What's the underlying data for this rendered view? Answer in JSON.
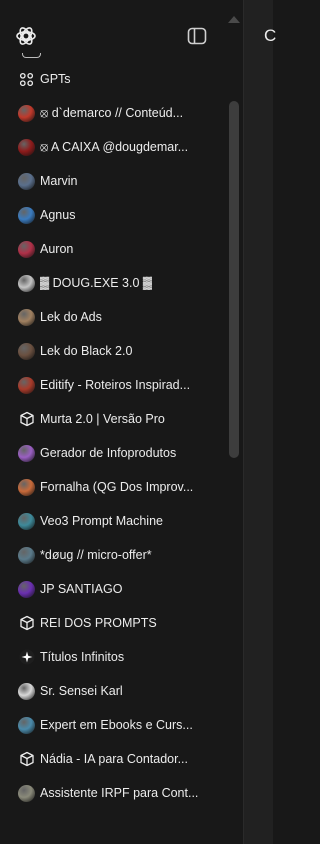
{
  "sidebar": {
    "items": [
      {
        "label": "GPTs",
        "icon": "grid-icon"
      },
      {
        "label": "⦻ d`demarco // Conteúd...",
        "icon": "avatar-ddemarco",
        "color": "#c0392b"
      },
      {
        "label": "⦻ A CAIXA @dougdemar...",
        "icon": "avatar-acaixa",
        "color": "#8e1b1b"
      },
      {
        "label": "Marvin",
        "icon": "avatar-marvin",
        "color": "#5a6f8c"
      },
      {
        "label": "Agnus",
        "icon": "avatar-agnus",
        "color": "#3a7bbf"
      },
      {
        "label": "Auron",
        "icon": "avatar-auron",
        "color": "#b03048"
      },
      {
        "label": "▓ DOUG.EXE 3.0 ▓",
        "icon": "avatar-dougexe",
        "color": "#c4c4c4"
      },
      {
        "label": "Lek do Ads",
        "icon": "avatar-lekads",
        "color": "#a08060"
      },
      {
        "label": "Lek do Black 2.0",
        "icon": "avatar-lekblack",
        "color": "#6a5040"
      },
      {
        "label": "Editify - Roteiros Inspirad...",
        "icon": "avatar-editify",
        "color": "#a83a2a"
      },
      {
        "label": "Murta 2.0 | Versão Pro",
        "icon": "cube-icon"
      },
      {
        "label": "Gerador de Infoprodutos",
        "icon": "avatar-gerador",
        "color": "#9a5fc2"
      },
      {
        "label": "Fornalha (QG Dos Improv...",
        "icon": "avatar-fornalha",
        "color": "#c86a3a"
      },
      {
        "label": "Veo3 Prompt Machine",
        "icon": "avatar-veo3",
        "color": "#3e8a9a"
      },
      {
        "label": "*døug // micro-offer*",
        "icon": "avatar-doug-micro",
        "color": "#5a7a8a"
      },
      {
        "label": "JP SANTIAGO",
        "icon": "avatar-jp",
        "color": "#6a2fb0"
      },
      {
        "label": "REI DOS PROMPTS",
        "icon": "cube-icon"
      },
      {
        "label": "Títulos Infinitos",
        "icon": "sparkle-icon"
      },
      {
        "label": "Sr. Sensei Karl",
        "icon": "avatar-sensei",
        "color": "#d8d8d8"
      },
      {
        "label": "Expert em Ebooks e Curs...",
        "icon": "avatar-expert",
        "color": "#4a8aaa"
      },
      {
        "label": "Nádia - IA para Contador...",
        "icon": "cube-icon"
      },
      {
        "label": "Assistente IRPF para Cont...",
        "icon": "avatar-irpf",
        "color": "#8a8a7a"
      }
    ]
  },
  "main": {
    "partial_text": "C"
  },
  "colors": {
    "sidebar_bg": "#181818",
    "main_bg": "#212121",
    "text": "#ececec"
  }
}
